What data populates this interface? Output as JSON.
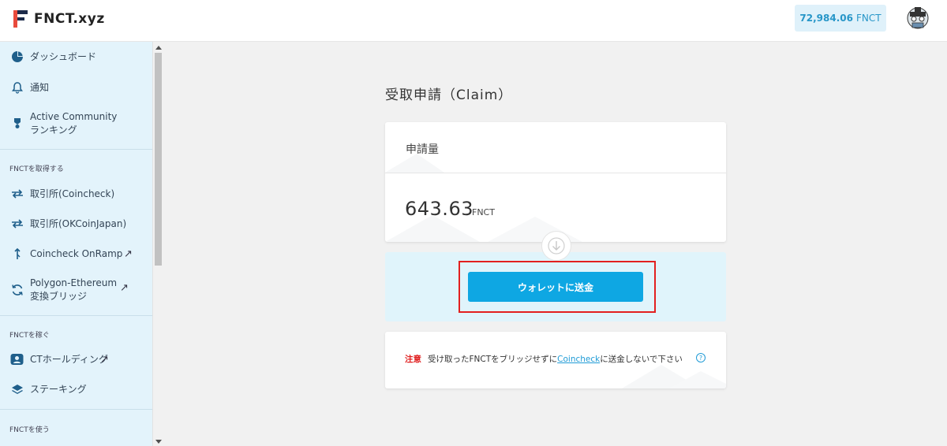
{
  "header": {
    "logo_text": "FNCT.xyz",
    "balance_amount": "72,984.06",
    "balance_unit": "FNCT"
  },
  "sidebar": {
    "items": [
      {
        "label": "ダッシュボード",
        "icon": "pie-chart-icon"
      },
      {
        "label": "通知",
        "icon": "bell-icon"
      },
      {
        "label_line1": "Active Community",
        "label_line2": "ランキング",
        "icon": "medal-icon"
      },
      {
        "label": "取引所(Coincheck)",
        "icon": "swap-arrows-icon"
      },
      {
        "label": "取引所(OKCoinJapan)",
        "icon": "swap-arrows-icon"
      },
      {
        "label": "Coincheck OnRamp",
        "icon": "up-arrow-icon",
        "external": true
      },
      {
        "label_line1": "Polygon-Ethereum",
        "label_line2": "変換ブリッジ",
        "icon": "refresh-icon",
        "external": true
      },
      {
        "label": "CTホールディング",
        "icon": "user-card-icon",
        "external": true
      },
      {
        "label": "ステーキング",
        "icon": "layers-icon"
      }
    ],
    "sections": [
      "FNCTを取得する",
      "FNCTを稼ぐ",
      "FNCTを使う"
    ],
    "external_glyph": "↗"
  },
  "main": {
    "title": "受取申請（Claim）",
    "amount_label": "申請量",
    "amount_value": "643.63",
    "amount_unit": "FNCT",
    "send_button": "ウォレットに送金",
    "note_warning": "注意",
    "note_before": "受け取ったFNCTをブリッジせずに",
    "note_link": "Coincheck",
    "note_after": "に送金しないで下さい",
    "help_glyph": "?"
  },
  "colors": {
    "accent": "#0ea7e3",
    "sidebar_bg": "#e3f3fb",
    "highlight": "#e2201f",
    "warning": "#e02020"
  }
}
